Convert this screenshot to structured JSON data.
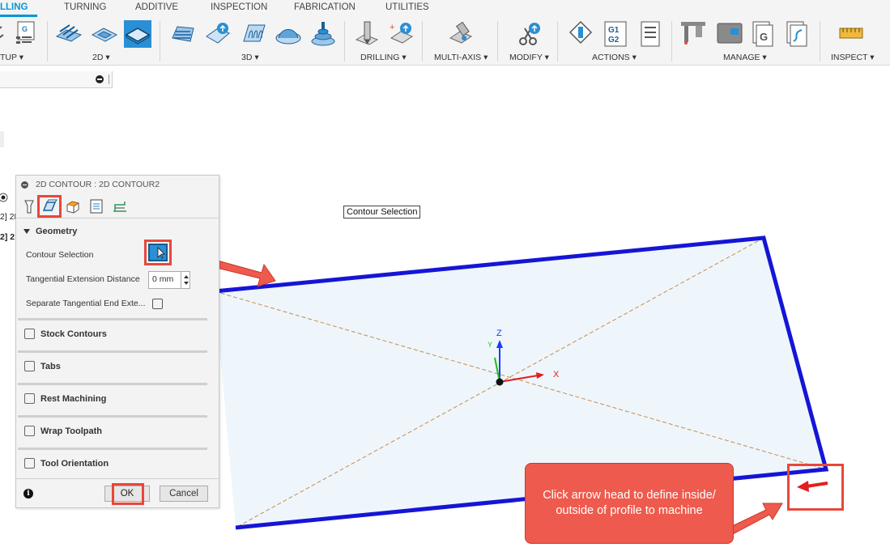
{
  "ribbon": {
    "tabs": [
      "LLING",
      "TURNING",
      "ADDITIVE",
      "INSPECTION",
      "FABRICATION",
      "UTILITIES"
    ],
    "groups": {
      "setup": "TUP",
      "twod": "2D",
      "threed": "3D",
      "drilling": "DRILLING",
      "multiaxis": "MULTI-AXIS",
      "modify": "MODIFY",
      "actions": "ACTIONS",
      "manage": "MANAGE",
      "inspect": "INSPECT"
    },
    "accent": "#0696d7"
  },
  "browser": {
    "fragments": [
      "2] 2D",
      "2] 2"
    ]
  },
  "dialog": {
    "title": "2D CONTOUR : 2D CONTOUR2",
    "geometry_header": "Geometry",
    "contour_selection_label": "Contour Selection",
    "tangential_ext_label": "Tangential Extension Distance",
    "tangential_ext_value": "0 mm",
    "separate_tangential_label": "Separate Tangential End Exte...",
    "sections": [
      "Stock Contours",
      "Tabs",
      "Rest Machining",
      "Wrap Toolpath",
      "Tool Orientation"
    ],
    "ok_label": "OK",
    "cancel_label": "Cancel"
  },
  "canvas": {
    "tooltip": "Contour Selection",
    "axes": {
      "z": "Z",
      "y": "Y",
      "x": "X"
    },
    "callout_text": "Click arrow head to define inside/ outside of profile to machine",
    "highlight_color": "#e8473b"
  }
}
